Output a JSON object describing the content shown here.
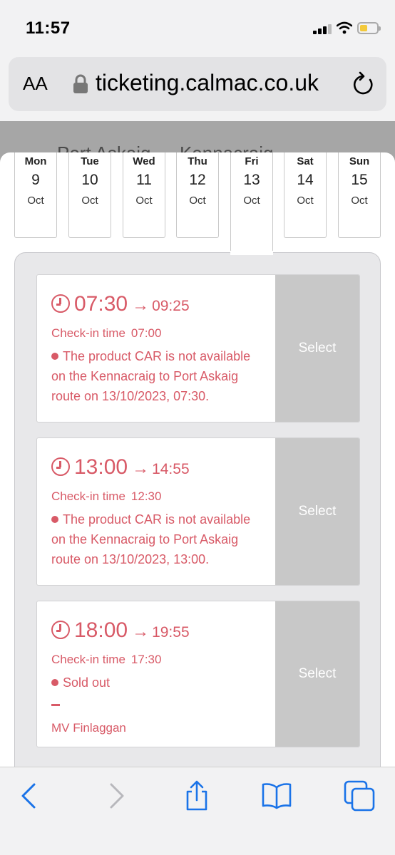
{
  "status": {
    "time": "11:57"
  },
  "browser": {
    "aa_label": "AA",
    "url": "ticketing.calmac.co.uk"
  },
  "route": {
    "title": "Port Askaig → Kennacraig"
  },
  "days": [
    {
      "name": "Mon",
      "num": "9",
      "month": "Oct"
    },
    {
      "name": "Tue",
      "num": "10",
      "month": "Oct"
    },
    {
      "name": "Wed",
      "num": "11",
      "month": "Oct"
    },
    {
      "name": "Thu",
      "num": "12",
      "month": "Oct"
    },
    {
      "name": "Fri",
      "num": "13",
      "month": "Oct",
      "selected": true
    },
    {
      "name": "Sat",
      "num": "14",
      "month": "Oct"
    },
    {
      "name": "Sun",
      "num": "15",
      "month": "Oct"
    }
  ],
  "sailings": [
    {
      "depart": "07:30",
      "arrow": "→",
      "arrive": "09:25",
      "checkin_label": "Check-in time",
      "checkin_time": "07:00",
      "message": "The product CAR is not available on the Kennacraig to Port Askaig route on 13/10/2023, 07:30.",
      "select_label": "Select"
    },
    {
      "depart": "13:00",
      "arrow": "→",
      "arrive": "14:55",
      "checkin_label": "Check-in time",
      "checkin_time": "12:30",
      "message": "The product CAR is not available on the Kennacraig to Port Askaig route on 13/10/2023, 13:00.",
      "select_label": "Select"
    },
    {
      "depart": "18:00",
      "arrow": "→",
      "arrive": "19:55",
      "checkin_label": "Check-in time",
      "checkin_time": "17:30",
      "message": "Sold out",
      "vessel": "MV Finlaggan",
      "select_label": "Select"
    }
  ],
  "colors": {
    "accent": "#d85a67",
    "ios_blue": "#1a73e8",
    "disabled": "#c8c8c8"
  }
}
